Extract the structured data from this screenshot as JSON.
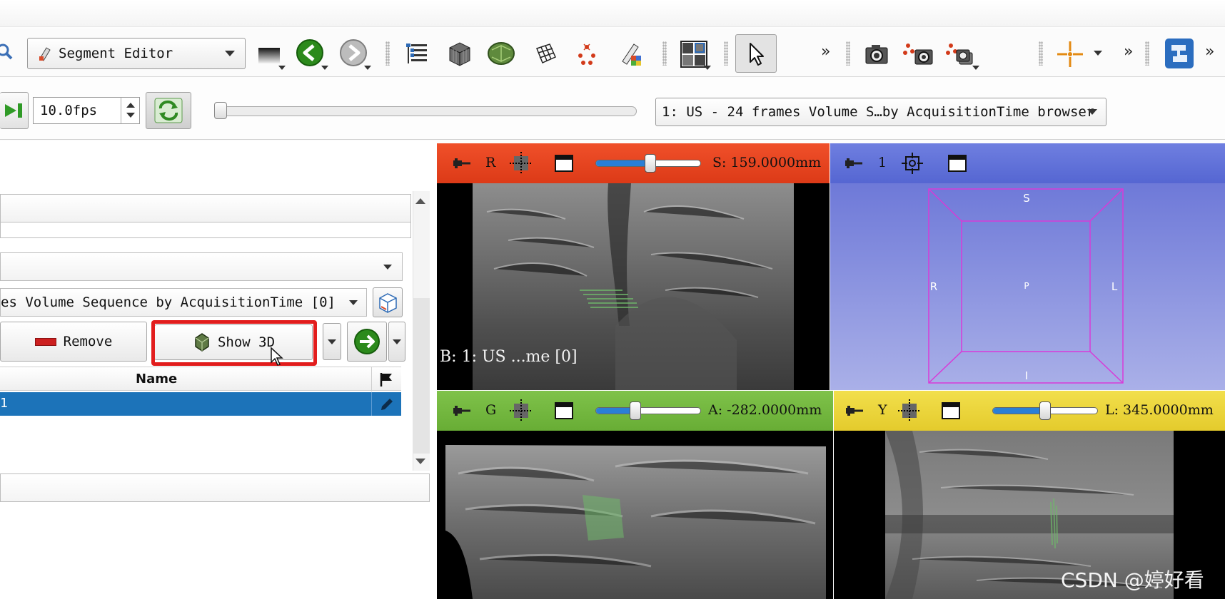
{
  "toolbar": {
    "module_label": "Segment Editor",
    "overflow_1": "»",
    "overflow_2": "»",
    "overflow_3": "»"
  },
  "playback": {
    "fps_value": "10.0fps",
    "browser_label": "1: US - 24 frames Volume S…by AcquisitionTime browser"
  },
  "segment_editor": {
    "source_volume": "es Volume Sequence by AcquisitionTime [0]",
    "remove_label": "Remove",
    "show3d_label": "Show 3D",
    "table_header_name": "Name",
    "row_1_name": "1"
  },
  "views": {
    "red": {
      "letter": "R",
      "offset": "S: 159.0000mm",
      "slider_fraction": 0.52,
      "overlay": "B: 1: US ...me [0]"
    },
    "three_d": {
      "label": "1",
      "orient_top": "S",
      "orient_bottom": "I",
      "orient_left": "R",
      "orient_right": "L",
      "orient_center": "P"
    },
    "green": {
      "letter": "G",
      "offset": "A: -282.0000mm",
      "slider_fraction": 0.38
    },
    "yellow": {
      "letter": "Y",
      "offset": "L: 345.0000mm",
      "slider_fraction": 0.5
    }
  },
  "watermark": "CSDN @婷好看",
  "colors": {
    "red_bar": "#e64520",
    "blue_bar": "#5f6fd9",
    "green_bar": "#74b83f",
    "yellow_bar": "#ebd63c",
    "selection": "#1c73b9",
    "highlight": "#e21d1d"
  }
}
